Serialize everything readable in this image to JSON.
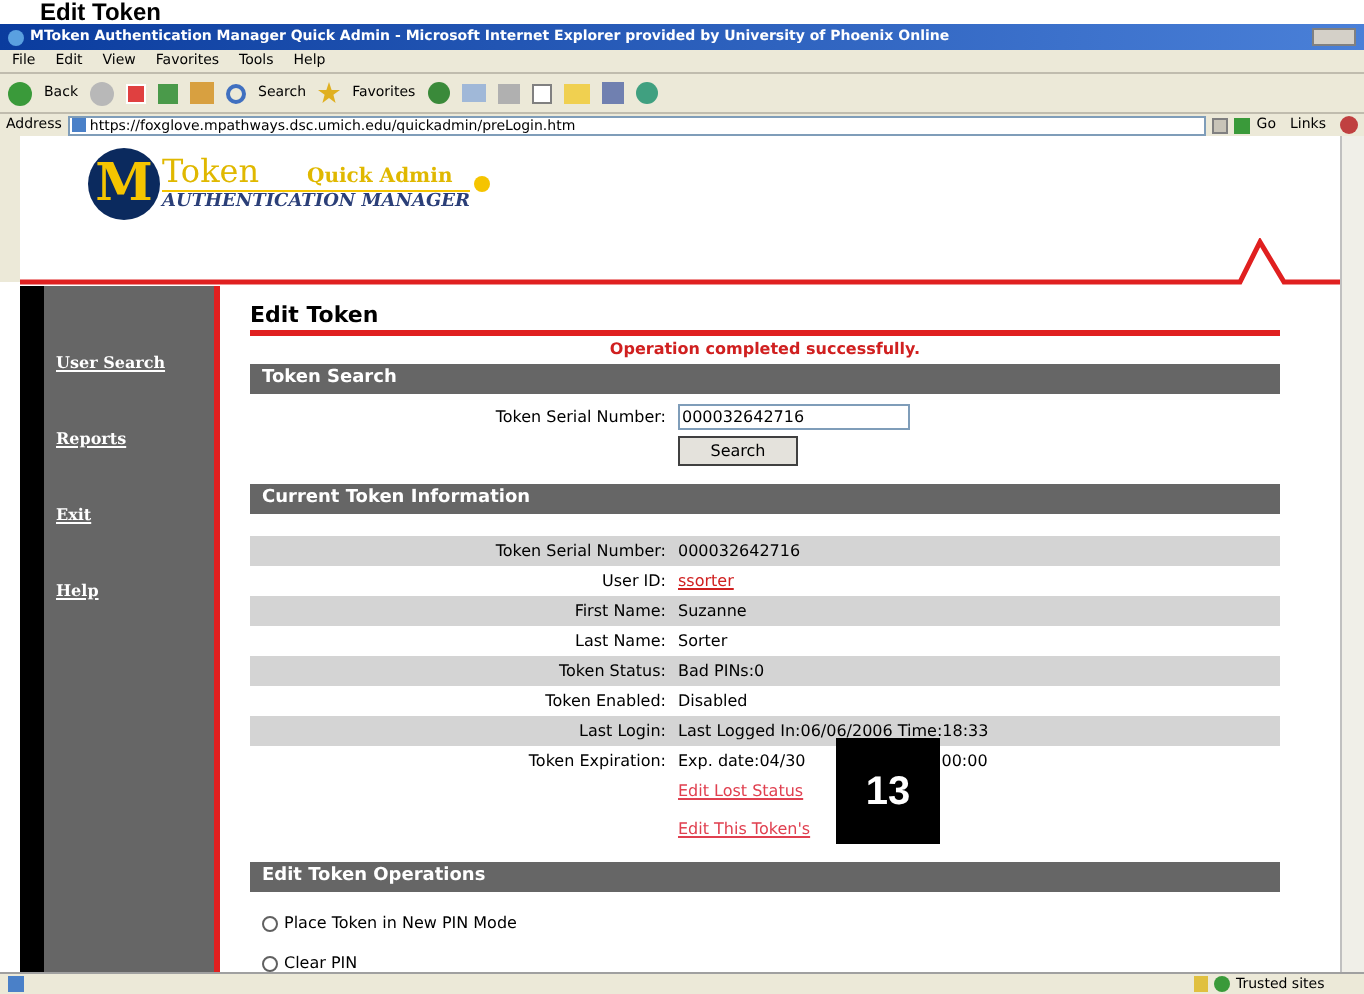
{
  "doc_heading": "Edit Token",
  "window": {
    "title": "MToken Authentication Manager Quick Admin - Microsoft Internet Explorer provided by University of Phoenix Online"
  },
  "menu": [
    "File",
    "Edit",
    "View",
    "Favorites",
    "Tools",
    "Help"
  ],
  "toolbar": {
    "back": "Back",
    "search": "Search",
    "favorites": "Favorites"
  },
  "address": {
    "label": "Address",
    "value": "https://foxglove.mpathways.dsc.umich.edu/quickadmin/preLogin.htm",
    "go": "Go",
    "links": "Links"
  },
  "logo": {
    "mark": "M",
    "name": "Token",
    "product": "Quick Admin",
    "subtitle": "AUTHENTICATION MANAGER"
  },
  "sidebar": {
    "items": [
      "User Search",
      "Reports",
      "Exit",
      "Help"
    ]
  },
  "page": {
    "title": "Edit Token",
    "message": "Operation completed successfully."
  },
  "token_search": {
    "heading": "Token Search",
    "label": "Token Serial Number:",
    "value": "000032642716",
    "button": "Search"
  },
  "token_info": {
    "heading": "Current Token Information",
    "rows": [
      {
        "label": "Token Serial Number:",
        "value": "000032642716",
        "kind": "text"
      },
      {
        "label": "User ID:",
        "value": "ssorter",
        "kind": "link"
      },
      {
        "label": "First Name:",
        "value": "Suzanne",
        "kind": "text"
      },
      {
        "label": "Last Name:",
        "value": "Sorter",
        "kind": "text"
      },
      {
        "label": "Token Status:",
        "value": "Bad PINs:0",
        "kind": "text"
      },
      {
        "label": "Token Enabled:",
        "value": "Disabled",
        "kind": "text"
      },
      {
        "label": "Last Login:",
        "value": "Last Logged In:06/06/2006 Time:18:33",
        "kind": "text"
      },
      {
        "label": "Token Expiration:",
        "value": "Exp. date:04/30",
        "value_end": "00:00",
        "kind": "split"
      }
    ],
    "links": [
      "Edit Lost Status",
      "Edit This Token's"
    ]
  },
  "operations": {
    "heading": "Edit Token Operations",
    "options": [
      {
        "label": "Place Token in New PIN Mode",
        "selected": false
      },
      {
        "label": "Clear PIN",
        "selected": false
      }
    ]
  },
  "step_badge": "13",
  "status_bar": {
    "zone": "Trusted sites"
  }
}
